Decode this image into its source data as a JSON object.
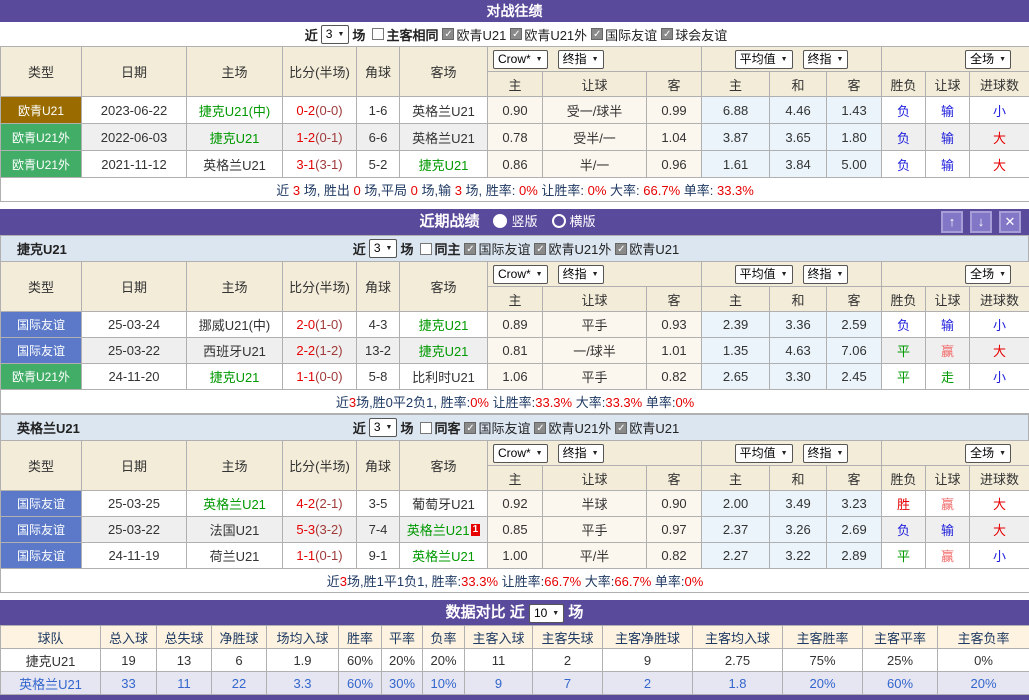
{
  "colors": {
    "purple": "#5a4a9c",
    "badge_brown": "#9a6c00",
    "badge_green": "#41ad67",
    "badge_blue": "#5b79c8",
    "team_green": "#009900",
    "score_red": "#e60000",
    "result_blue": "#2020dd"
  },
  "h2h": {
    "title": "对战往绩",
    "filter": {
      "near": "近",
      "count": "3",
      "unit": "场",
      "checkboxes": [
        {
          "label": "主客相同",
          "checked": false
        },
        {
          "label": "欧青U21",
          "checked": true
        },
        {
          "label": "欧青U21外",
          "checked": true
        },
        {
          "label": "国际友谊",
          "checked": true
        },
        {
          "label": "球会友谊",
          "checked": true
        }
      ]
    },
    "selects": {
      "odds": "Crow*",
      "odds_time": "终指",
      "avg": "平均值",
      "avg_time": "终指",
      "scope": "全场"
    },
    "columns": [
      "类型",
      "日期",
      "主场",
      "比分(半场)",
      "角球",
      "客场",
      "主",
      "让球",
      "客",
      "主",
      "和",
      "客",
      "胜负",
      "让球",
      "进球数"
    ],
    "rows": [
      {
        "type": "欧青U21",
        "badge": "brown",
        "date": "2023-06-22",
        "home": "捷克U21(中)",
        "home_green": true,
        "score": "0-2",
        "half": "(0-0)",
        "corner": "1-6",
        "away": "英格兰U21",
        "away_green": false,
        "away_card": "",
        "odds": [
          "0.90",
          "受一/球半",
          "0.99"
        ],
        "avg": [
          "6.88",
          "4.46",
          "1.43"
        ],
        "res": [
          [
            "负",
            "blue"
          ],
          [
            "输",
            "blue"
          ],
          [
            "小",
            "blue"
          ]
        ]
      },
      {
        "type": "欧青U21外",
        "badge": "green",
        "date": "2022-06-03",
        "home": "捷克U21",
        "home_green": true,
        "score": "1-2",
        "half": "(0-1)",
        "corner": "6-6",
        "away": "英格兰U21",
        "away_green": false,
        "away_card": "",
        "odds": [
          "0.78",
          "受半/一",
          "1.04"
        ],
        "avg": [
          "3.87",
          "3.65",
          "1.80"
        ],
        "res": [
          [
            "负",
            "blue"
          ],
          [
            "输",
            "blue"
          ],
          [
            "大",
            "red"
          ]
        ]
      },
      {
        "type": "欧青U21外",
        "badge": "green",
        "date": "2021-11-12",
        "home": "英格兰U21",
        "home_green": false,
        "score": "3-1",
        "half": "(3-1)",
        "corner": "5-2",
        "away": "捷克U21",
        "away_green": true,
        "away_card": "",
        "odds": [
          "0.86",
          "半/一",
          "0.96"
        ],
        "avg": [
          "1.61",
          "3.84",
          "5.00"
        ],
        "res": [
          [
            "负",
            "blue"
          ],
          [
            "输",
            "blue"
          ],
          [
            "大",
            "red"
          ]
        ]
      }
    ],
    "summary": [
      {
        "t": "近 ",
        "r": false
      },
      {
        "t": "3",
        "r": true
      },
      {
        "t": " 场, 胜出 ",
        "r": false
      },
      {
        "t": "0",
        "r": true
      },
      {
        "t": " 场,平局 ",
        "r": false
      },
      {
        "t": "0",
        "r": true
      },
      {
        "t": " 场,输 ",
        "r": false
      },
      {
        "t": "3",
        "r": true
      },
      {
        "t": " 场, 胜率: ",
        "r": false
      },
      {
        "t": "0%",
        "r": true
      },
      {
        "t": " 让胜率: ",
        "r": false
      },
      {
        "t": "0%",
        "r": true
      },
      {
        "t": " 大率: ",
        "r": false
      },
      {
        "t": "66.7%",
        "r": true
      },
      {
        "t": " 单率: ",
        "r": false
      },
      {
        "t": "33.3%",
        "r": true
      }
    ]
  },
  "recent": {
    "title": "近期战绩",
    "radios": [
      {
        "label": "竖版",
        "selected": true
      },
      {
        "label": "横版",
        "selected": false
      }
    ],
    "window_buttons": [
      {
        "name": "up-arrow",
        "glyph": "↑"
      },
      {
        "name": "down-arrow",
        "glyph": "↓"
      },
      {
        "name": "close",
        "glyph": "✕"
      }
    ],
    "teams": [
      {
        "name": "捷克U21",
        "filter": {
          "near": "近",
          "count": "3",
          "unit": "场",
          "checkboxes": [
            {
              "label": "同主",
              "checked": false
            },
            {
              "label": "国际友谊",
              "checked": true
            },
            {
              "label": "欧青U21外",
              "checked": true
            },
            {
              "label": "欧青U21",
              "checked": true
            }
          ]
        },
        "selects": {
          "odds": "Crow*",
          "odds_time": "终指",
          "avg": "平均值",
          "avg_time": "终指",
          "scope": "全场"
        },
        "columns": [
          "类型",
          "日期",
          "主场",
          "比分(半场)",
          "角球",
          "客场",
          "主",
          "让球",
          "客",
          "主",
          "和",
          "客",
          "胜负",
          "让球",
          "进球数"
        ],
        "rows": [
          {
            "type": "国际友谊",
            "badge": "blue",
            "date": "25-03-24",
            "home": "挪威U21(中)",
            "home_green": false,
            "score": "2-0",
            "half": "(1-0)",
            "corner": "4-3",
            "away": "捷克U21",
            "away_green": true,
            "away_card": "",
            "odds": [
              "0.89",
              "平手",
              "0.93"
            ],
            "avg": [
              "2.39",
              "3.36",
              "2.59"
            ],
            "res": [
              [
                "负",
                "blue"
              ],
              [
                "输",
                "blue"
              ],
              [
                "小",
                "blue"
              ]
            ]
          },
          {
            "type": "国际友谊",
            "badge": "blue",
            "date": "25-03-22",
            "home": "西班牙U21",
            "home_green": false,
            "score": "2-2",
            "half": "(1-2)",
            "corner": "13-2",
            "away": "捷克U21",
            "away_green": true,
            "away_card": "",
            "odds": [
              "0.81",
              "一/球半",
              "1.01"
            ],
            "avg": [
              "1.35",
              "4.63",
              "7.06"
            ],
            "res": [
              [
                "平",
                "green"
              ],
              [
                "赢",
                "lred"
              ],
              [
                "大",
                "red"
              ]
            ]
          },
          {
            "type": "欧青U21外",
            "badge": "green",
            "date": "24-11-20",
            "home": "捷克U21",
            "home_green": true,
            "score": "1-1",
            "half": "(0-0)",
            "corner": "5-8",
            "away": "比利时U21",
            "away_green": false,
            "away_card": "",
            "odds": [
              "1.06",
              "平手",
              "0.82"
            ],
            "avg": [
              "2.65",
              "3.30",
              "2.45"
            ],
            "res": [
              [
                "平",
                "green"
              ],
              [
                "走",
                "green"
              ],
              [
                "小",
                "blue"
              ]
            ]
          }
        ],
        "summary": [
          {
            "t": "近",
            "r": false
          },
          {
            "t": "3",
            "r": true
          },
          {
            "t": "场,胜0平2负1, 胜率:",
            "r": false
          },
          {
            "t": "0%",
            "r": true
          },
          {
            "t": " 让胜率:",
            "r": false
          },
          {
            "t": "33.3%",
            "r": true
          },
          {
            "t": " 大率:",
            "r": false
          },
          {
            "t": "33.3%",
            "r": true
          },
          {
            "t": " 单率:",
            "r": false
          },
          {
            "t": "0%",
            "r": true
          }
        ]
      },
      {
        "name": "英格兰U21",
        "filter": {
          "near": "近",
          "count": "3",
          "unit": "场",
          "checkboxes": [
            {
              "label": "同客",
              "checked": false
            },
            {
              "label": "国际友谊",
              "checked": true
            },
            {
              "label": "欧青U21外",
              "checked": true
            },
            {
              "label": "欧青U21",
              "checked": true
            }
          ]
        },
        "selects": {
          "odds": "Crow*",
          "odds_time": "终指",
          "avg": "平均值",
          "avg_time": "终指",
          "scope": "全场"
        },
        "columns": [
          "类型",
          "日期",
          "主场",
          "比分(半场)",
          "角球",
          "客场",
          "主",
          "让球",
          "客",
          "主",
          "和",
          "客",
          "胜负",
          "让球",
          "进球数"
        ],
        "rows": [
          {
            "type": "国际友谊",
            "badge": "blue",
            "date": "25-03-25",
            "home": "英格兰U21",
            "home_green": true,
            "score": "4-2",
            "half": "(2-1)",
            "corner": "3-5",
            "away": "葡萄牙U21",
            "away_green": false,
            "away_card": "",
            "odds": [
              "0.92",
              "半球",
              "0.90"
            ],
            "avg": [
              "2.00",
              "3.49",
              "3.23"
            ],
            "res": [
              [
                "胜",
                "red"
              ],
              [
                "赢",
                "lred"
              ],
              [
                "大",
                "red"
              ]
            ]
          },
          {
            "type": "国际友谊",
            "badge": "blue",
            "date": "25-03-22",
            "home": "法国U21",
            "home_green": false,
            "score": "5-3",
            "half": "(3-2)",
            "corner": "7-4",
            "away": "英格兰U21",
            "away_green": true,
            "away_card": "1",
            "odds": [
              "0.85",
              "平手",
              "0.97"
            ],
            "avg": [
              "2.37",
              "3.26",
              "2.69"
            ],
            "res": [
              [
                "负",
                "blue"
              ],
              [
                "输",
                "blue"
              ],
              [
                "大",
                "red"
              ]
            ]
          },
          {
            "type": "国际友谊",
            "badge": "blue",
            "date": "24-11-19",
            "home": "荷兰U21",
            "home_green": false,
            "score": "1-1",
            "half": "(0-1)",
            "corner": "9-1",
            "away": "英格兰U21",
            "away_green": true,
            "away_card": "",
            "odds": [
              "1.00",
              "平/半",
              "0.82"
            ],
            "avg": [
              "2.27",
              "3.22",
              "2.89"
            ],
            "res": [
              [
                "平",
                "green"
              ],
              [
                "赢",
                "lred"
              ],
              [
                "小",
                "blue"
              ]
            ]
          }
        ],
        "summary": [
          {
            "t": "近",
            "r": false
          },
          {
            "t": "3",
            "r": true
          },
          {
            "t": "场,胜1平1负1, 胜率:",
            "r": false
          },
          {
            "t": "33.3%",
            "r": true
          },
          {
            "t": " 让胜率:",
            "r": false
          },
          {
            "t": "66.7%",
            "r": true
          },
          {
            "t": " 大率:",
            "r": false
          },
          {
            "t": "66.7%",
            "r": true
          },
          {
            "t": " 单率:",
            "r": false
          },
          {
            "t": "0%",
            "r": true
          }
        ]
      }
    ]
  },
  "compare": {
    "title": "数据对比",
    "near": "近",
    "count": "10",
    "unit": "场",
    "columns": [
      "球队",
      "总入球",
      "总失球",
      "净胜球",
      "场均入球",
      "胜率",
      "平率",
      "负率",
      "主客入球",
      "主客失球",
      "主客净胜球",
      "主客均入球",
      "主客胜率",
      "主客平率",
      "主客负率"
    ],
    "chart_data": {
      "type": "table",
      "rows": [
        {
          "team": "捷克U21",
          "values": [
            "19",
            "13",
            "6",
            "1.9",
            "60%",
            "20%",
            "20%",
            "11",
            "2",
            "9",
            "2.75",
            "75%",
            "25%",
            "0%"
          ]
        },
        {
          "team": "英格兰U21",
          "values": [
            "33",
            "11",
            "22",
            "3.3",
            "60%",
            "30%",
            "10%",
            "9",
            "7",
            "2",
            "1.8",
            "20%",
            "60%",
            "20%"
          ]
        }
      ]
    }
  }
}
